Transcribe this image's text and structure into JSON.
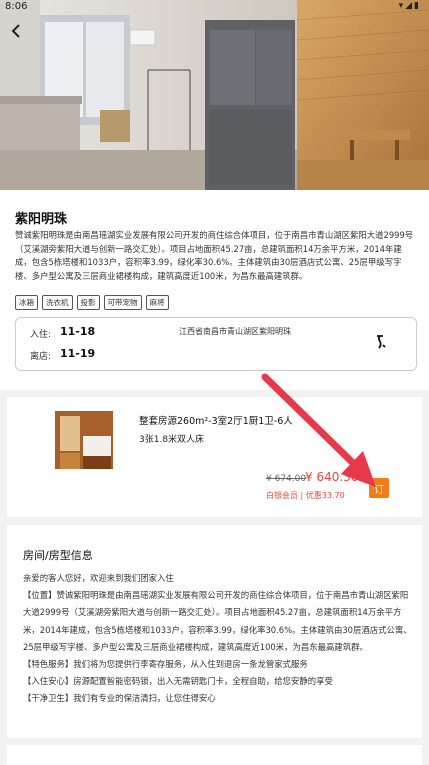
{
  "status": {
    "time": "8:06",
    "icons": "signal-wifi-battery"
  },
  "hotel": {
    "name": "紫阳明珠",
    "description": "赞诚紫阳明珠是由南昌瑶湖实业发展有限公司开发的商住综合体项目，位于南昌市青山湖区紫阳大道2999号（艾溪湖旁紫阳大道与创新一路交汇处）。项目占地面积45.27亩，总建筑面积14万余平方米，2014年建成，包含5栋塔楼和1033户，容积率3.99，绿化率30.6%。主体建筑由30层酒店式公寓、25层甲级写字楼、多户型公寓及三层商业裙楼构成，建筑高度近100米，为昌东最高建筑群。",
    "tags": [
      "冰箱",
      "洗衣机",
      "投影",
      "可带宠物",
      "麻将"
    ],
    "checkin_label": "入住:",
    "checkin": "11-18",
    "checkout_label": "离店:",
    "checkout": "11-19",
    "address": "江西省南昌市青山湖区紫阳明珠"
  },
  "room": {
    "name": "整套房源260m²-3室2厅1厨1卫-6人",
    "beds": "3张1.8米双人床",
    "old_price": "¥ 674.00",
    "price": "¥ 640.30",
    "member": "白银会员 | 优惠33.70",
    "book_label": "订"
  },
  "room_info": {
    "title": "房间/房型信息",
    "greeting": "亲爱的客人您好，欢迎来到我们团家入住",
    "location": "【位置】赞诚紫阳明珠是由南昌瑶湖实业发展有限公司开发的商住综合体项目，位于南昌市青山湖区紫阳大道2999号（艾溪湖旁紫阳大道与创新一路交汇处）。项目占地面积45.27亩，总建筑面积14万余平方米，2014年建成，包含5栋塔楼和1033户，容积率3.99，绿化率30.6%。主体建筑由30层酒店式公寓、25层甲级写字楼、多户型公寓及三层商业裙楼构成，建筑高度近100米，为昌东最高建筑群。",
    "feature": "【特色服务】我们将为您提供行李寄存服务，从入住到退房一条龙管家式服务",
    "safety": "【入住安心】房源配置智能密码锁，出入无需钥匙门卡，全程自助，给您安静的享受",
    "clean": "【干净卫生】我们有专业的保洁清扫，让您住得安心"
  },
  "colors": {
    "accent": "#f07d18",
    "price": "#e8453c",
    "arrow": "#e8384a"
  }
}
